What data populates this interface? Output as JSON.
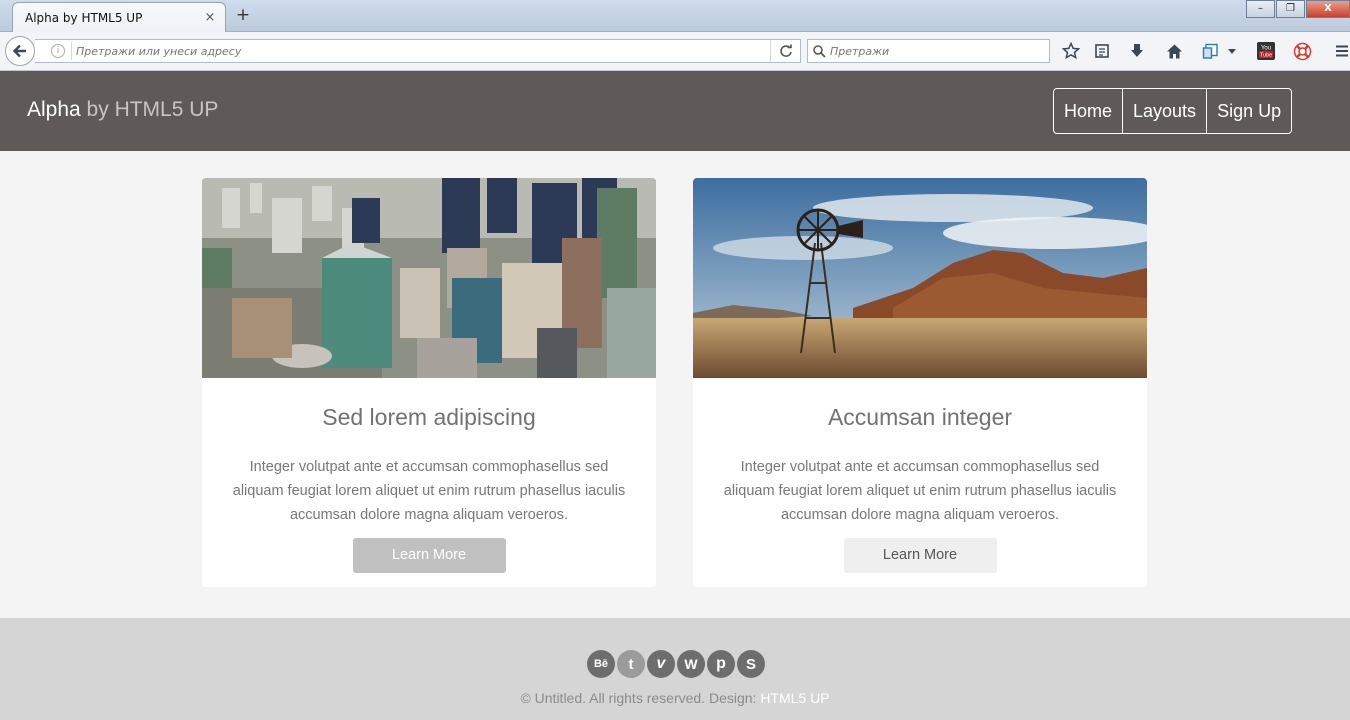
{
  "browser": {
    "tab_title": "Alpha by HTML5 UP",
    "tab_close": "×",
    "new_tab": "+",
    "window_controls": [
      "–",
      "❐",
      "X"
    ],
    "url_placeholder": "Претражи или унеси адресу",
    "search_placeholder": "Претражи"
  },
  "header": {
    "logo_main": "Alpha",
    "logo_sub": " by HTML5 UP",
    "menu": [
      "Home",
      "Layouts",
      "Sign Up"
    ]
  },
  "cards": [
    {
      "title": "Sed lorem adipiscing",
      "text": "Integer volutpat ante et accumsan commophasellus sed aliquam feugiat lorem aliquet ut enim rutrum phasellus iaculis accumsan dolore magna aliquam veroeros.",
      "button": "Learn More"
    },
    {
      "title": "Accumsan integer",
      "text": "Integer volutpat ante et accumsan commophasellus sed aliquam feugiat lorem aliquet ut enim rutrum phasellus iaculis accumsan dolore magna aliquam veroeros.",
      "button": "Learn More"
    }
  ],
  "footer": {
    "socials": [
      {
        "icon": "behance-icon",
        "glyph": "Bē",
        "color": "#6d6d6d"
      },
      {
        "icon": "tumblr-icon",
        "glyph": "t",
        "color": "#9b9b9b"
      },
      {
        "icon": "vimeo-icon",
        "glyph": "v",
        "color": "#6d6d6d"
      },
      {
        "icon": "wordpress-icon",
        "glyph": "W",
        "color": "#6d6d6d"
      },
      {
        "icon": "pinterest-icon",
        "glyph": "p",
        "color": "#6d6d6d"
      },
      {
        "icon": "skype-icon",
        "glyph": "S",
        "color": "#6d6d6d"
      }
    ],
    "copyright": "© Untitled. All rights reserved. Design: ",
    "design_link": "HTML5 UP"
  },
  "colors": {
    "header_bg": "#5f5a58",
    "page_bg": "#f4f4f4",
    "footer_bg": "#d5d5d5"
  }
}
